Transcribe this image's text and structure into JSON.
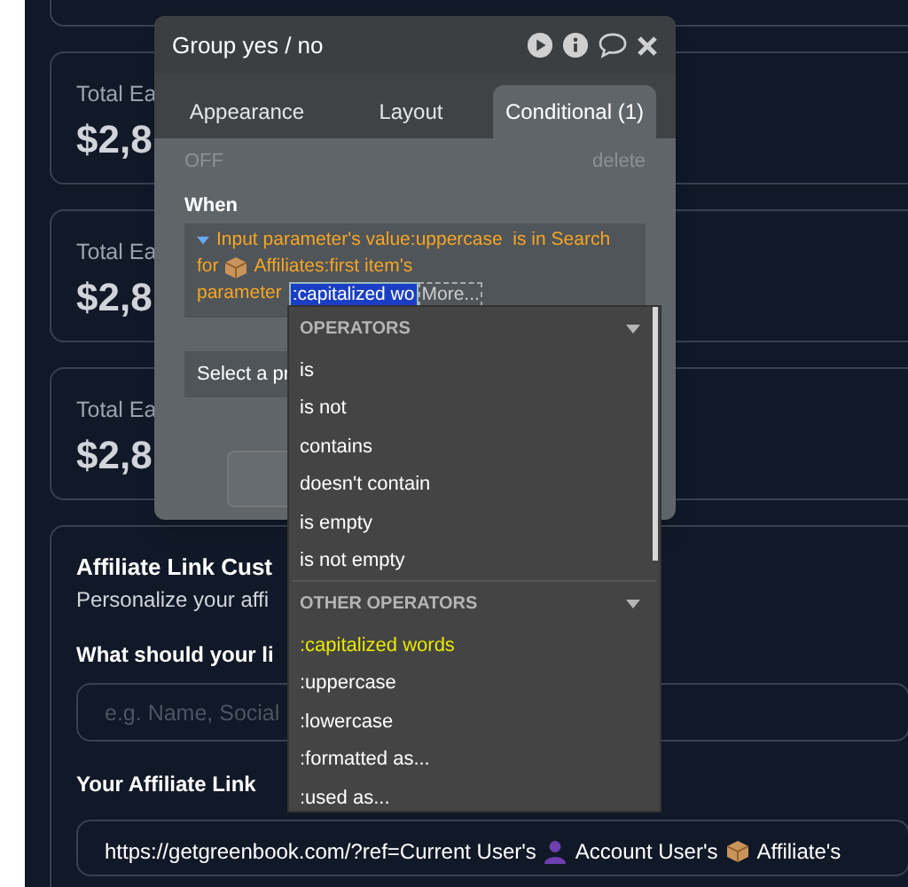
{
  "stat_cards": [
    {
      "label": "Total Ea",
      "value": "$2,8"
    },
    {
      "label": "Total Ea",
      "value": "$2,8"
    },
    {
      "label": "Total Ea",
      "value": "$2,8"
    }
  ],
  "affiliate_card": {
    "title": "Affiliate Link Cust",
    "subtitle": "Personalize your affi",
    "name_label": "What should your li",
    "name_field": {
      "placeholder": "e.g. Name, Social"
    },
    "link_label": "Your Affiliate Link",
    "link_parts": [
      {
        "kind": "text",
        "text": "https://getgreenbook.com/?ref=Current User's"
      },
      {
        "kind": "person"
      },
      {
        "kind": "text",
        "text": "Account User's"
      },
      {
        "kind": "package"
      },
      {
        "kind": "text",
        "text": "Affiliate's"
      }
    ]
  },
  "popup": {
    "title": "Group yes / no",
    "tabs": [
      {
        "label": "Appearance",
        "selected": false
      },
      {
        "label": "Layout",
        "selected": false
      },
      {
        "label": "Conditional (1)",
        "selected": true
      }
    ],
    "status": "OFF",
    "delete": "delete",
    "when_label": "When",
    "expression_lines": [
      [
        {
          "kind": "caret"
        },
        {
          "kind": "text",
          "text": "Input parameter's value:uppercase  is in Search"
        }
      ],
      [
        {
          "kind": "text",
          "text": "for"
        },
        {
          "kind": "package"
        },
        {
          "kind": "text",
          "text": "Affiliates:first item's"
        }
      ],
      [
        {
          "kind": "text",
          "text": "parameter"
        },
        {
          "kind": "chip",
          "text": ":capitalized wo"
        },
        {
          "kind": "more",
          "text": "More..."
        }
      ]
    ],
    "property_select": "Select a pr"
  },
  "dropdown": {
    "sections": [
      {
        "title": "OPERATORS",
        "items": [
          {
            "label": "is",
            "selected": false
          },
          {
            "label": "is not",
            "selected": false
          },
          {
            "label": "contains",
            "selected": false
          },
          {
            "label": "doesn't contain",
            "selected": false
          },
          {
            "label": "is empty",
            "selected": false
          },
          {
            "label": "is not empty",
            "selected": false
          }
        ]
      },
      {
        "title": "OTHER OPERATORS",
        "items": [
          {
            "label": ":capitalized words",
            "selected": true
          },
          {
            "label": ":uppercase",
            "selected": false
          },
          {
            "label": ":lowercase",
            "selected": false
          },
          {
            "label": ":formatted as...",
            "selected": false
          },
          {
            "label": ":used as...",
            "selected": false
          }
        ]
      }
    ]
  }
}
